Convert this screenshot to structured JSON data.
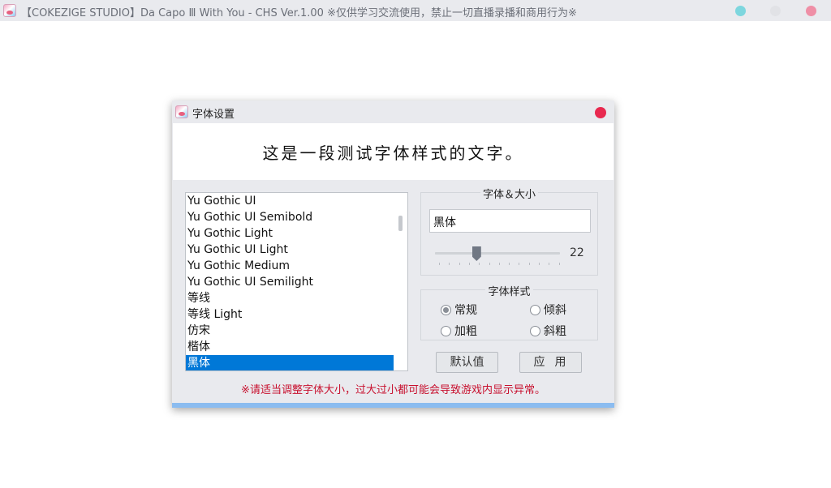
{
  "window": {
    "title": "【COKEZIGE STUDIO】Da Capo Ⅲ With You - CHS Ver.1.00 ※仅供学习交流使用，禁止一切直播录播和商用行为※",
    "colors": {
      "minimize": "#7dd6de",
      "maximize": "#e1e2e6",
      "close": "#ef8fa6"
    }
  },
  "dialog": {
    "title": "字体设置",
    "preview_text": "这是一段测试字体样式的文字。",
    "font_list": [
      "Yu Gothic UI",
      "Yu Gothic UI Semibold",
      "Yu Gothic Light",
      "Yu Gothic UI Light",
      "Yu Gothic Medium",
      "Yu Gothic UI Semilight",
      "等线",
      "等线 Light",
      "仿宋",
      "楷体",
      "黑体"
    ],
    "selected_font": "黑体",
    "font_size_group": {
      "label": "字体＆大小",
      "font_value": "黑体",
      "size_value": "22",
      "size_level_fraction": 0.33
    },
    "style_group": {
      "label": "字体样式",
      "options": [
        "常规",
        "倾斜",
        "加粗",
        "斜粗"
      ],
      "selected": "常规"
    },
    "buttons": {
      "default_label": "默认值",
      "apply_label": "应用"
    },
    "warning": "※请适当调整字体大小，过大过小都可能会导致游戏内显示异常。",
    "colors": {
      "close": "#e8294f",
      "selection": "#0078d7",
      "warning": "#c8102e",
      "accent_bar": "#8bbcf0"
    }
  }
}
